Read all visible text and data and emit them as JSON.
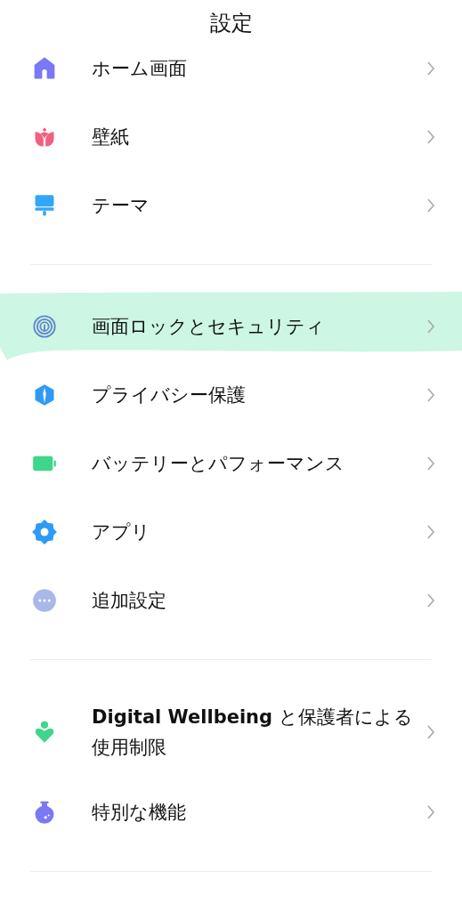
{
  "title": "設定",
  "groups": [
    {
      "items": [
        {
          "kind": "home",
          "label": "ホーム画面",
          "highlighted": false
        },
        {
          "kind": "tulip",
          "label": "壁紙",
          "highlighted": false
        },
        {
          "kind": "brush",
          "label": "テーマ",
          "highlighted": false
        }
      ]
    },
    {
      "items": [
        {
          "kind": "fingerprint",
          "label": "画面ロックとセキュリティ",
          "highlighted": true
        },
        {
          "kind": "shield",
          "label": "プライバシー保護",
          "highlighted": false
        },
        {
          "kind": "battery",
          "label": "バッテリーとパフォーマンス",
          "highlighted": false
        },
        {
          "kind": "gear",
          "label": "アプリ",
          "highlighted": false
        },
        {
          "kind": "more",
          "label": "追加設定",
          "highlighted": false
        }
      ]
    },
    {
      "items": [
        {
          "kind": "person-heart",
          "label": "**Digital Wellbeing** と保護者による使用制限",
          "highlighted": false
        },
        {
          "kind": "flask",
          "label": "特別な機能",
          "highlighted": false
        }
      ]
    }
  ]
}
